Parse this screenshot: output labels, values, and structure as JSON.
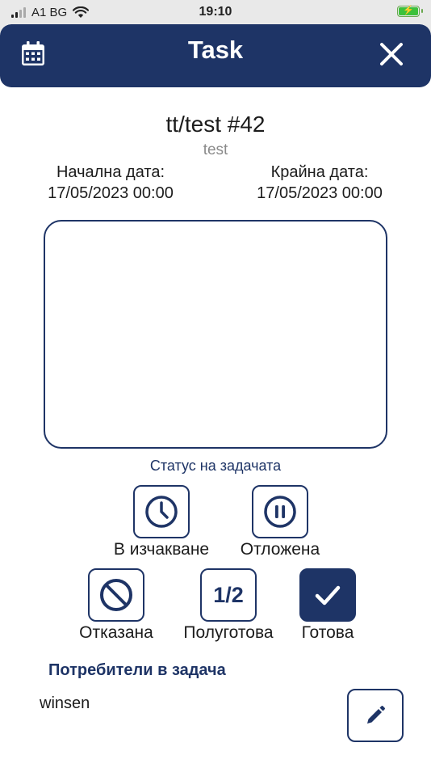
{
  "status_bar": {
    "carrier": "A1 BG",
    "time": "19:10"
  },
  "header": {
    "title": "Task",
    "calendar_icon": "calendar-icon",
    "close_icon": "close-icon"
  },
  "task": {
    "title": "tt/test #42",
    "subtitle": "test",
    "start_label": "Начална дата:",
    "start_value": "17/05/2023 00:00",
    "end_label": "Крайна дата:",
    "end_value": "17/05/2023 00:00",
    "description": ""
  },
  "status": {
    "caption": "Статус на задачата",
    "options": [
      {
        "label": "В изчакване",
        "icon": "clock-icon",
        "selected": false
      },
      {
        "label": "Отложена",
        "icon": "pause-icon",
        "selected": false
      },
      {
        "label": "Отказана",
        "icon": "ban-icon",
        "selected": false
      },
      {
        "label": "Полуготова",
        "icon": "1/2",
        "selected": false
      },
      {
        "label": "Готова",
        "icon": "check-icon",
        "selected": true
      }
    ]
  },
  "users": {
    "title": "Потребители в задача",
    "list": [
      "winsen"
    ],
    "edit_icon": "pencil-icon"
  },
  "colors": {
    "primary": "#1e3466",
    "battery": "#3cc13b"
  }
}
